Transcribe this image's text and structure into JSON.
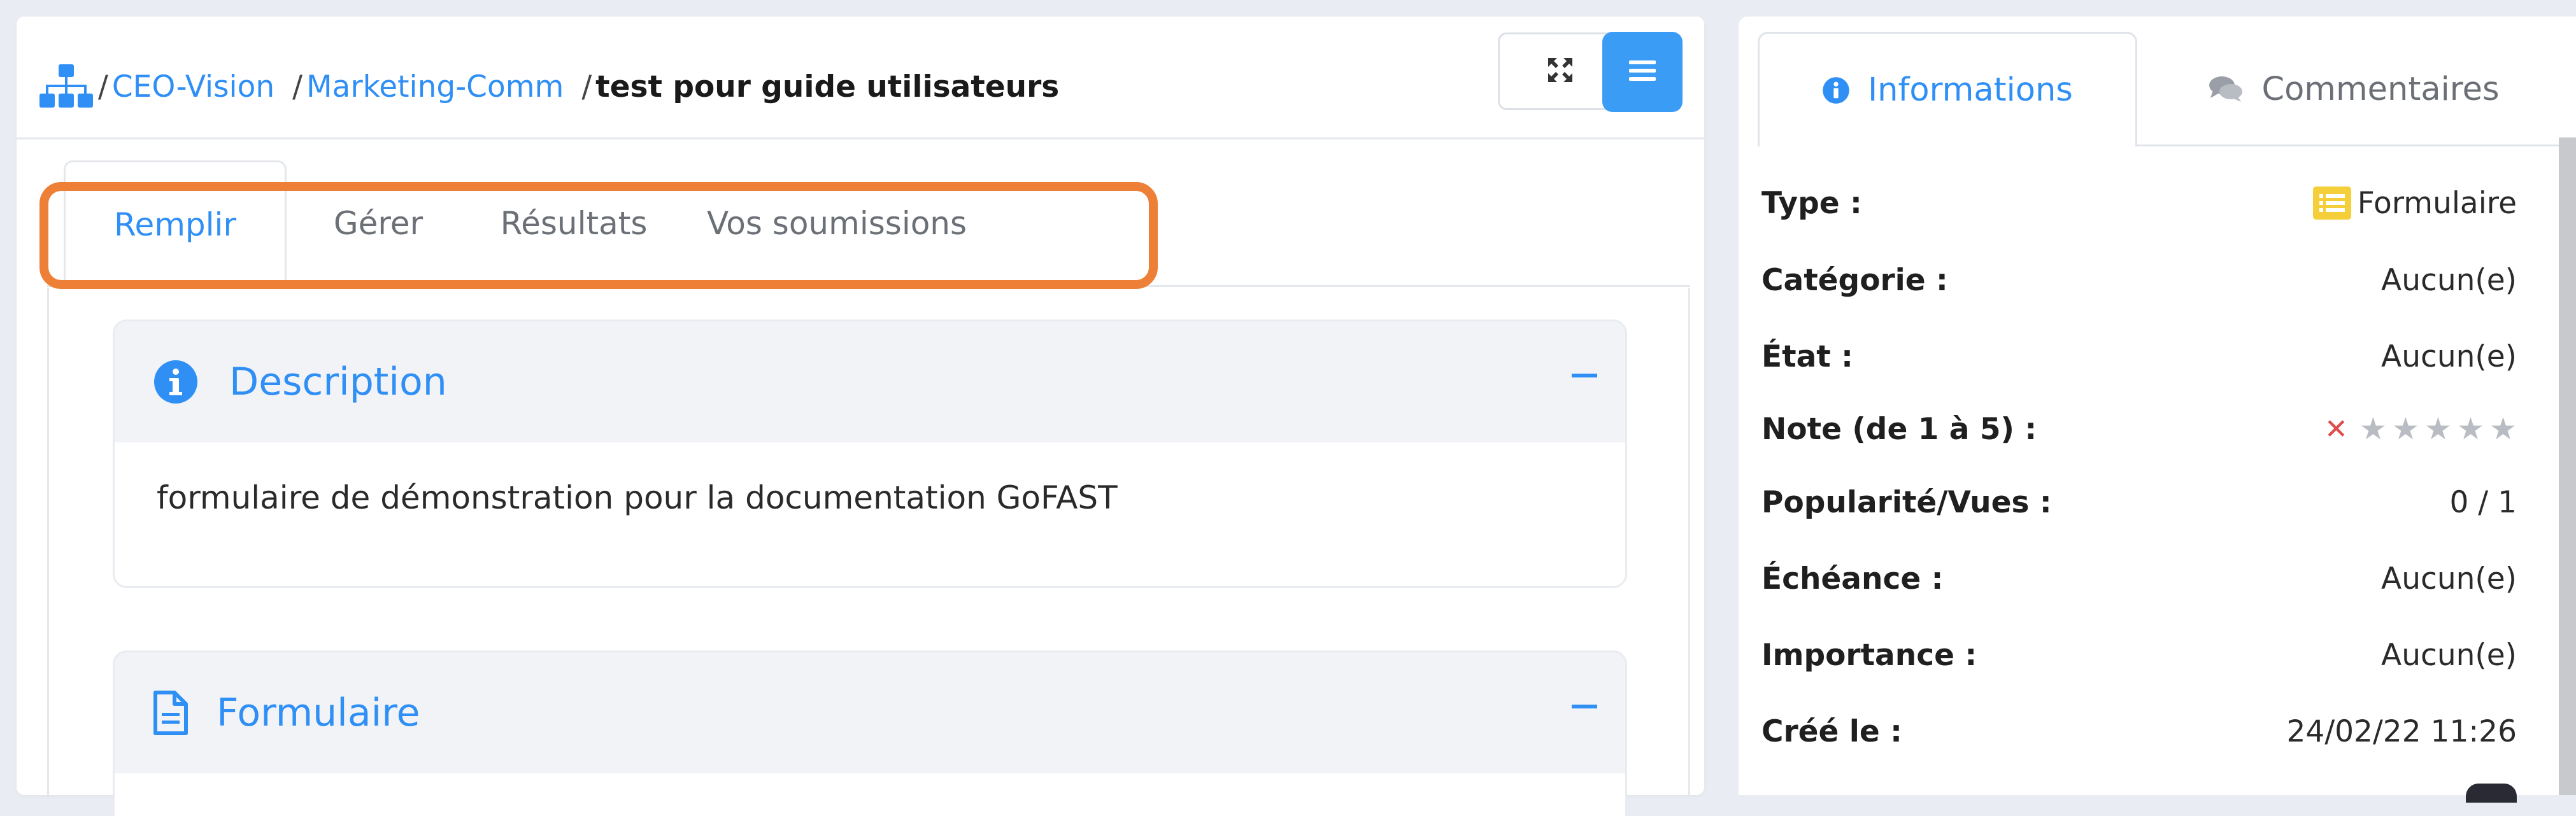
{
  "breadcrumb": {
    "items": [
      "CEO-Vision",
      "Marketing-Comm"
    ],
    "current": "test pour guide utilisateurs",
    "separator": "/"
  },
  "toolbar": {
    "expand_icon": "expand-arrows-icon",
    "menu_icon": "hamburger-menu-icon"
  },
  "tabs": [
    {
      "label": "Remplir",
      "active": true
    },
    {
      "label": "Gérer",
      "active": false
    },
    {
      "label": "Résultats",
      "active": false
    },
    {
      "label": "Vos soumissions",
      "active": false
    }
  ],
  "description": {
    "title": "Description",
    "text": "formulaire de démonstration pour la documentation GoFAST"
  },
  "form_section": {
    "title": "Formulaire"
  },
  "side_tabs": {
    "informations": "Informations",
    "commentaires": "Commentaires"
  },
  "info": {
    "type_label": "Type :",
    "type_value": "Formulaire",
    "categorie_label": "Catégorie :",
    "categorie_value": "Aucun(e)",
    "etat_label": "État :",
    "etat_value": "Aucun(e)",
    "note_label": "Note (de 1 à 5) :",
    "note_value": 0,
    "note_max": 5,
    "popularite_label": "Popularité/Vues :",
    "popularite_value": "0 / 1",
    "echeance_label": "Échéance :",
    "echeance_value": "Aucun(e)",
    "importance_label": "Importance :",
    "importance_value": "Aucun(e)",
    "cree_label": "Créé le :",
    "cree_value": "24/02/22 11:26"
  },
  "colors": {
    "accent": "#2f8ff5",
    "highlight": "#ee7f36",
    "menu_button": "#3b9cf6"
  }
}
